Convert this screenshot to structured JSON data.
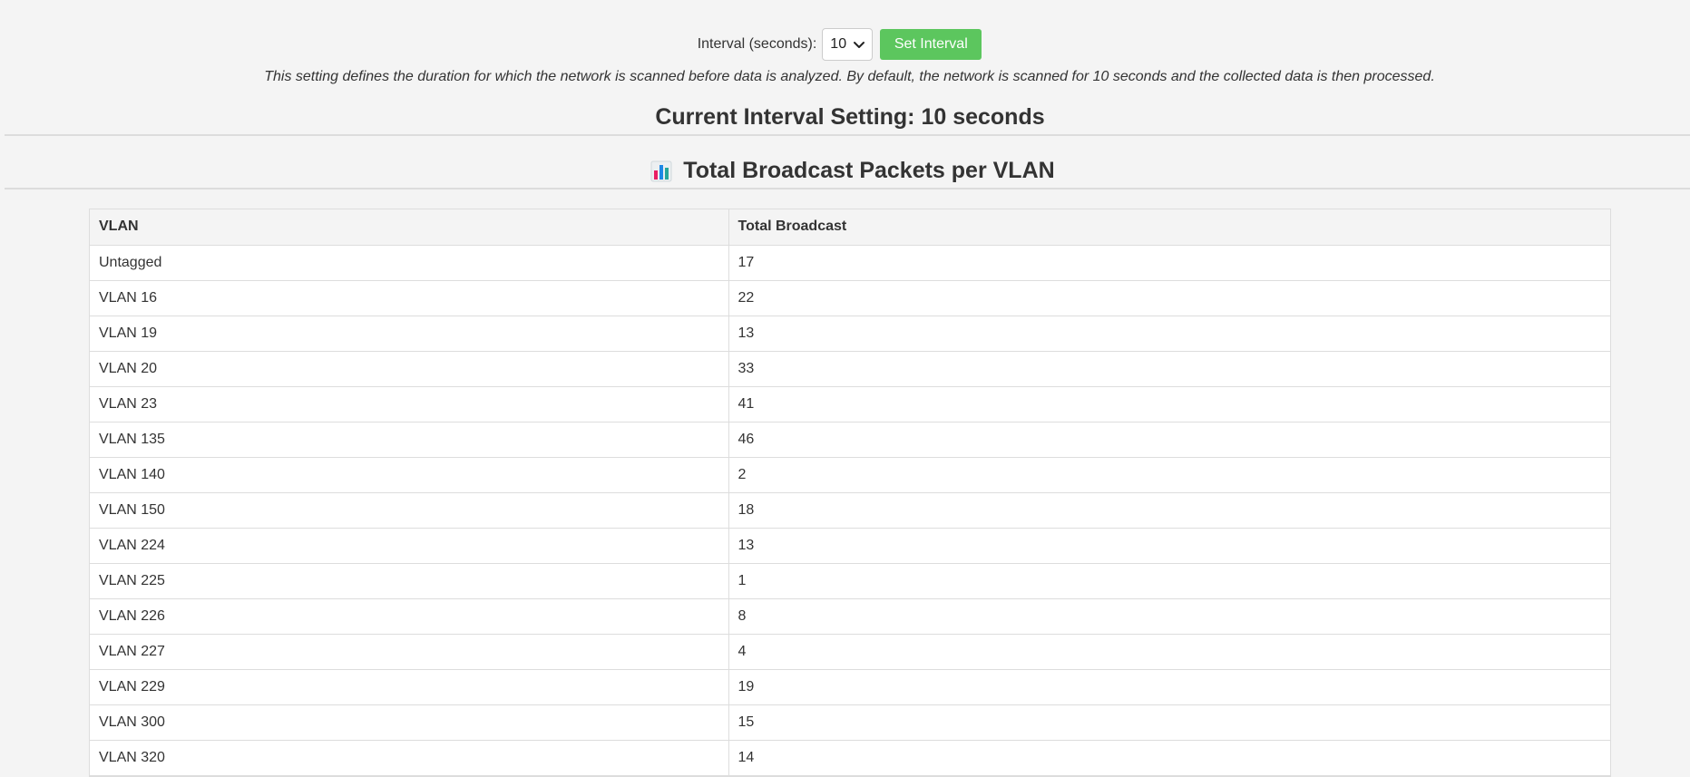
{
  "interval": {
    "label": "Interval (seconds):",
    "selected_value": "10",
    "button_label": "Set Interval"
  },
  "description": "This setting defines the duration for which the network is scanned before data is analyzed. By default, the network is scanned for 10 seconds and the collected data is then processed.",
  "current_setting": "Current Interval Setting: 10 seconds",
  "section": {
    "title": "Total Broadcast Packets per VLAN",
    "icon": "bar-chart-icon"
  },
  "table": {
    "columns": [
      "VLAN",
      "Total Broadcast"
    ],
    "rows": [
      [
        "Untagged",
        "17"
      ],
      [
        "VLAN 16",
        "22"
      ],
      [
        "VLAN 19",
        "13"
      ],
      [
        "VLAN 20",
        "33"
      ],
      [
        "VLAN 23",
        "41"
      ],
      [
        "VLAN 135",
        "46"
      ],
      [
        "VLAN 140",
        "2"
      ],
      [
        "VLAN 150",
        "18"
      ],
      [
        "VLAN 224",
        "13"
      ],
      [
        "VLAN 225",
        "1"
      ],
      [
        "VLAN 226",
        "8"
      ],
      [
        "VLAN 227",
        "4"
      ],
      [
        "VLAN 229",
        "19"
      ],
      [
        "VLAN 300",
        "15"
      ],
      [
        "VLAN 320",
        "14"
      ]
    ]
  },
  "colors": {
    "button": "#5cc65e",
    "background": "#f4f4f4",
    "text": "#333333",
    "icon_bars": [
      "#e91e63",
      "#1e88e5",
      "#26a69a"
    ]
  }
}
